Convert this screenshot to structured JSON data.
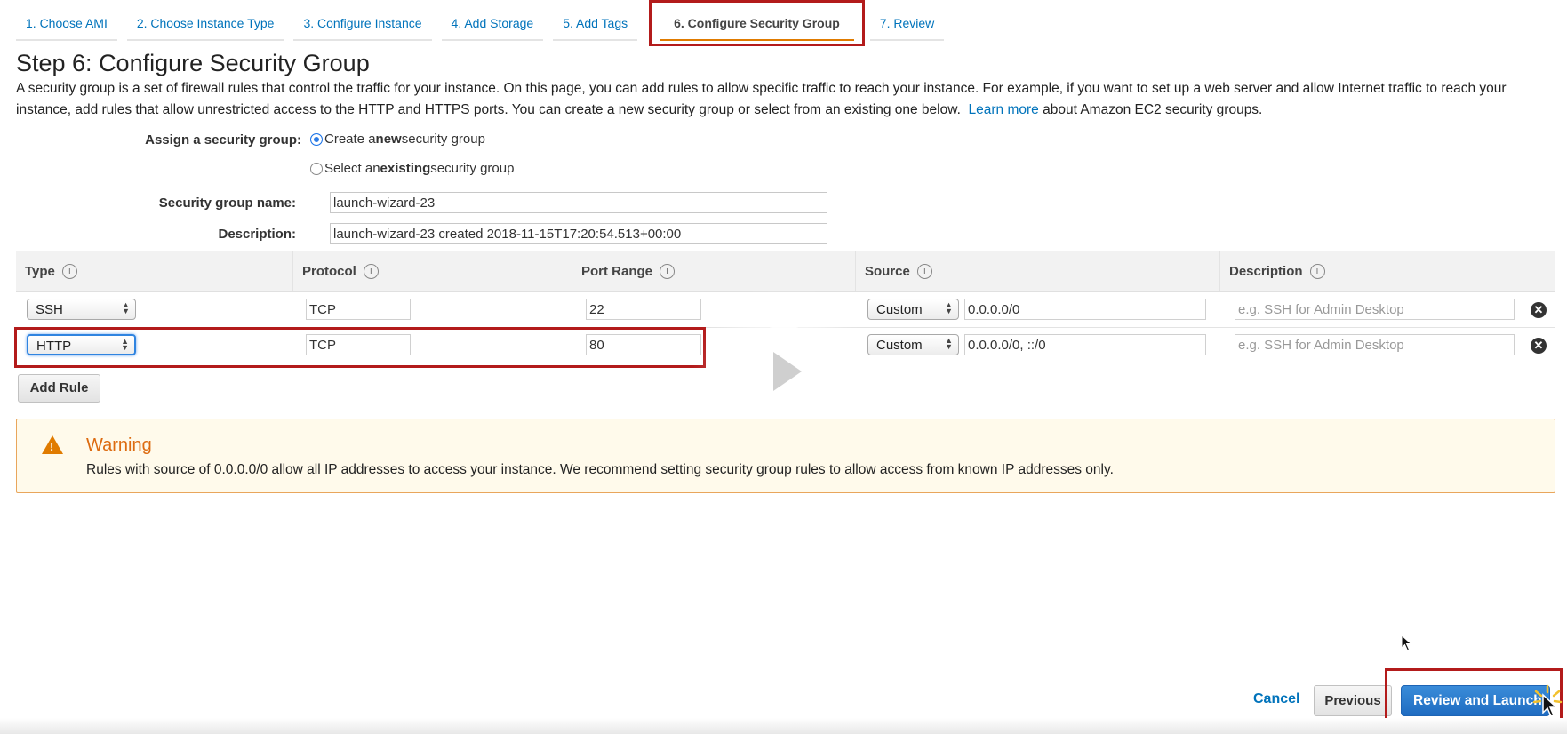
{
  "tabs": [
    {
      "label": "1. Choose AMI"
    },
    {
      "label": "2. Choose Instance Type"
    },
    {
      "label": "3. Configure Instance"
    },
    {
      "label": "4. Add Storage"
    },
    {
      "label": "5. Add Tags"
    },
    {
      "label": "6. Configure Security Group",
      "active": true
    },
    {
      "label": "7. Review"
    }
  ],
  "page": {
    "title": "Step 6: Configure Security Group",
    "intro_text": "A security group is a set of firewall rules that control the traffic for your instance. On this page, you can add rules to allow specific traffic to reach your instance. For example, if you want to set up a web server and allow Internet traffic to reach your instance, add rules that allow unrestricted access to the HTTP and HTTPS ports. You can create a new security group or select from an existing one below.",
    "learn_more": "Learn more",
    "learn_more_suffix": "about Amazon EC2 security groups."
  },
  "form": {
    "assign_label": "Assign a security group:",
    "option_new_pre": "Create a ",
    "option_new_bold": "new",
    "option_new_post": " security group",
    "option_existing_pre": "Select an ",
    "option_existing_bold": "existing",
    "option_existing_post": " security group",
    "selected_option": "new",
    "name_label": "Security group name:",
    "name_value": "launch-wizard-23",
    "description_label": "Description:",
    "description_value": "launch-wizard-23 created 2018-11-15T17:20:54.513+00:00"
  },
  "table": {
    "headers": [
      "Type",
      "Protocol",
      "Port Range",
      "Source",
      "Description"
    ],
    "rows": [
      {
        "type": "SSH",
        "protocol": "TCP",
        "port_range": "22",
        "source_mode": "Custom",
        "source": "0.0.0.0/0",
        "description_placeholder": "e.g. SSH for Admin Desktop"
      },
      {
        "type": "HTTP",
        "protocol": "TCP",
        "port_range": "80",
        "source_mode": "Custom",
        "source": "0.0.0.0/0, ::/0",
        "description_placeholder": "e.g. SSH for Admin Desktop"
      }
    ],
    "add_rule": "Add Rule"
  },
  "warning": {
    "title": "Warning",
    "text": "Rules with source of 0.0.0.0/0 allow all IP addresses to access your instance. We recommend setting security group rules to allow access from known IP addresses only."
  },
  "footer": {
    "cancel": "Cancel",
    "previous": "Previous",
    "review_launch": "Review and Launch"
  },
  "colors": {
    "link": "#0073bb",
    "active_tab_underline": "#e07b00",
    "highlight_box": "#b31b1b",
    "primary_button": "#1f6cc1",
    "warning_title": "#dd6b10"
  },
  "icons": {
    "info": "info-icon",
    "remove": "remove-circle-icon",
    "warning": "warning-triangle-icon",
    "play": "play-icon",
    "cursor": "mouse-pointer-icon"
  }
}
